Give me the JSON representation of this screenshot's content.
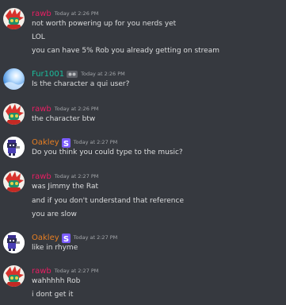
{
  "colors": {
    "background": "#36393f",
    "text": "#dcddde",
    "timestamp": "#a3a6aa",
    "rawb": "#e91e63",
    "fur": "#1abc9c",
    "oakley": "#e67e22"
  },
  "messages": [
    {
      "author": "rawb",
      "timestamp": "Today at 2:26 PM",
      "avatar_icon": "red-character-avatar",
      "lines": [
        "not worth powering up for you nerds yet",
        "LOL",
        "you can have 5% Rob you already getting on stream"
      ]
    },
    {
      "author": "Fur1001",
      "timestamp": "Today at 2:26 PM",
      "avatar_icon": "blue-sky-avatar",
      "badge_icon": "bot-badge-icon",
      "lines": [
        "Is the character a qui user?"
      ]
    },
    {
      "author": "rawb",
      "timestamp": "Today at 2:26 PM",
      "avatar_icon": "red-character-avatar",
      "lines": [
        "the character btw"
      ]
    },
    {
      "author": "Oakley",
      "timestamp": "Today at 2:27 PM",
      "avatar_icon": "pixel-character-avatar",
      "badge_icon": "purple-s-badge-icon",
      "lines": [
        "Do you think you could type to the music?"
      ]
    },
    {
      "author": "rawb",
      "timestamp": "Today at 2:27 PM",
      "avatar_icon": "red-character-avatar",
      "lines": [
        "was Jimmy the Rat",
        "and if you don't understand that reference",
        "you are slow"
      ]
    },
    {
      "author": "Oakley",
      "timestamp": "Today at 2:27 PM",
      "avatar_icon": "pixel-character-avatar",
      "badge_icon": "purple-s-badge-icon",
      "lines": [
        "like in rhyme"
      ]
    },
    {
      "author": "rawb",
      "timestamp": "Today at 2:27 PM",
      "avatar_icon": "red-character-avatar",
      "lines": [
        "wahhhhh Rob",
        "i dont get it"
      ]
    }
  ]
}
